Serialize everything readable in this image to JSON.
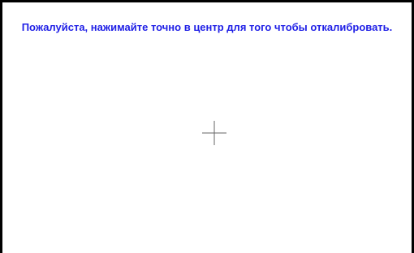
{
  "calibration": {
    "instruction": "Пожалуйста, нажимайте точно в центр для того чтобы откалибровать.",
    "target_icon": "crosshair-icon"
  },
  "colors": {
    "text": "#1f1fe6",
    "border": "#000000",
    "background": "#ffffff",
    "crosshair": "#666666"
  }
}
